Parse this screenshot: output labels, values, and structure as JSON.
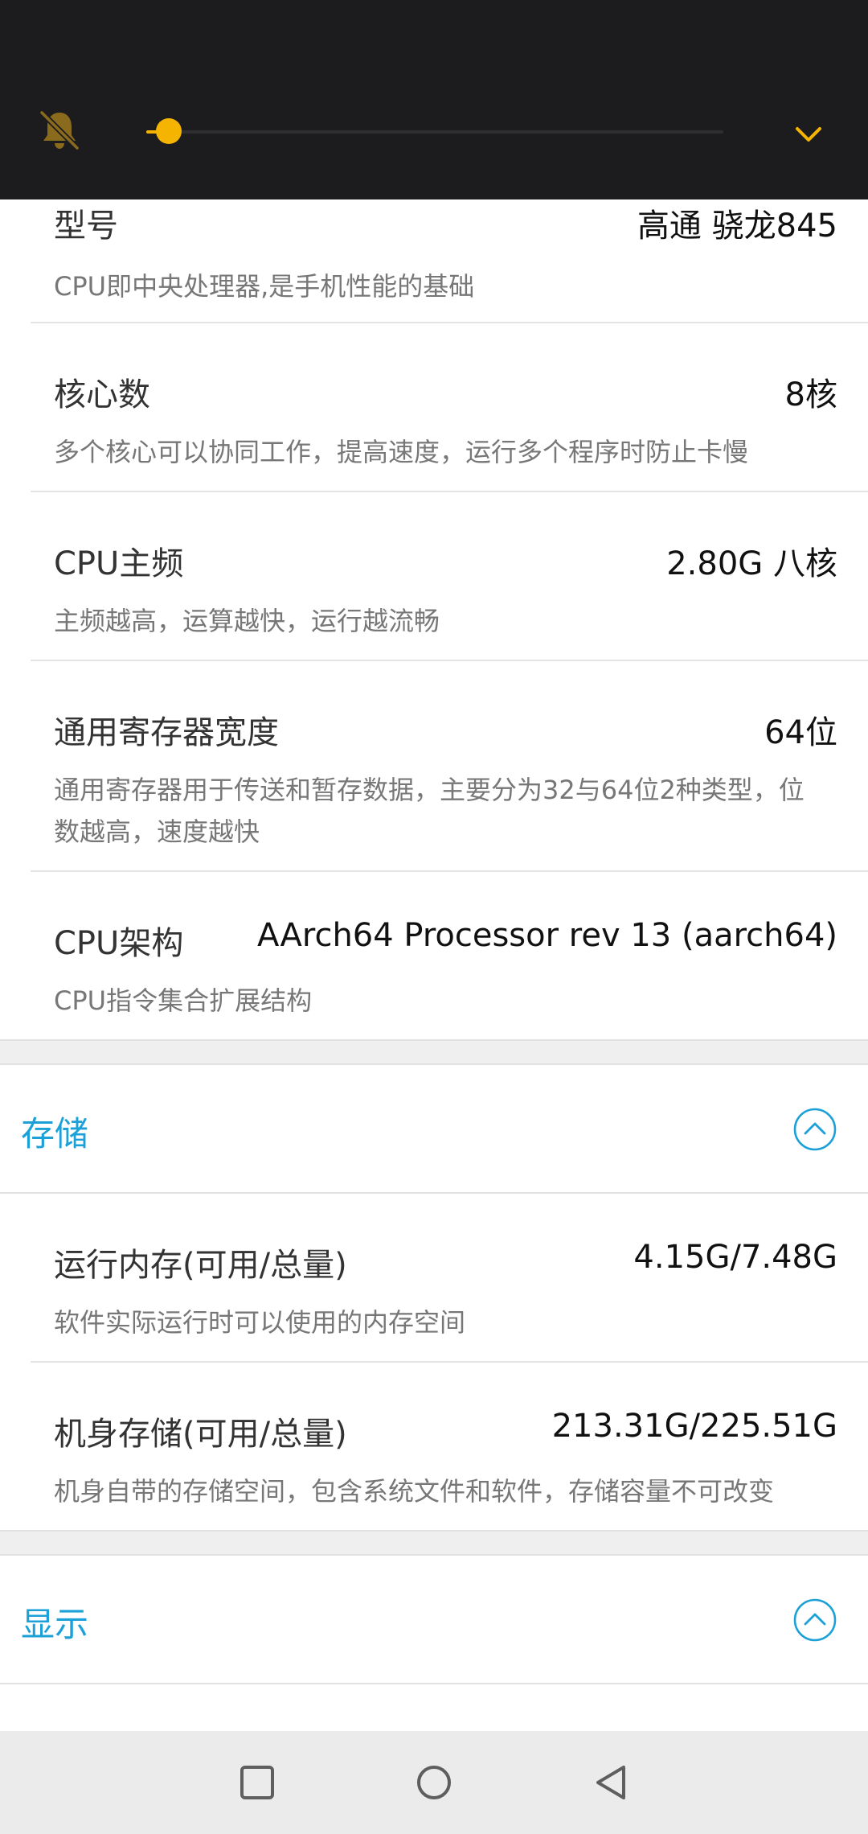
{
  "cpu_rows": [
    {
      "label": "型号",
      "value": "高通 骁龙845",
      "desc": "CPU即中央处理器,是手机性能的基础"
    },
    {
      "label": "核心数",
      "value": "8核",
      "desc": "多个核心可以协同工作，提高速度，运行多个程序时防止卡慢"
    },
    {
      "label": "CPU主频",
      "value": "2.80G 八核",
      "desc": "主频越高，运算越快，运行越流畅"
    },
    {
      "label": "通用寄存器宽度",
      "value": "64位",
      "desc": "通用寄存器用于传送和暂存数据，主要分为32与64位2种类型，位数越高，速度越快"
    },
    {
      "label": "CPU架构",
      "value": "AArch64 Processor rev 13 (aarch64)",
      "desc": "CPU指令集合扩展结构"
    }
  ],
  "storage": {
    "title": "存储",
    "rows": [
      {
        "label": "运行内存(可用/总量)",
        "value": "4.15G/7.48G",
        "desc": "软件实际运行时可以使用的内存空间"
      },
      {
        "label": "机身存储(可用/总量)",
        "value": "213.31G/225.51G",
        "desc": "机身自带的存储空间，包含系统文件和软件，存储容量不可改变"
      }
    ]
  },
  "display": {
    "title": "显示"
  },
  "volume": {
    "level": 0.02
  },
  "colors": {
    "accent": "#1ba1d8",
    "volume": "#f5b400"
  },
  "icons": {
    "bell": "bell-muted-icon",
    "expand": "chevron-down-icon",
    "collapse": "chevron-up-circle-icon",
    "nav_recents": "square-icon",
    "nav_home": "circle-icon",
    "nav_back": "triangle-back-icon"
  }
}
